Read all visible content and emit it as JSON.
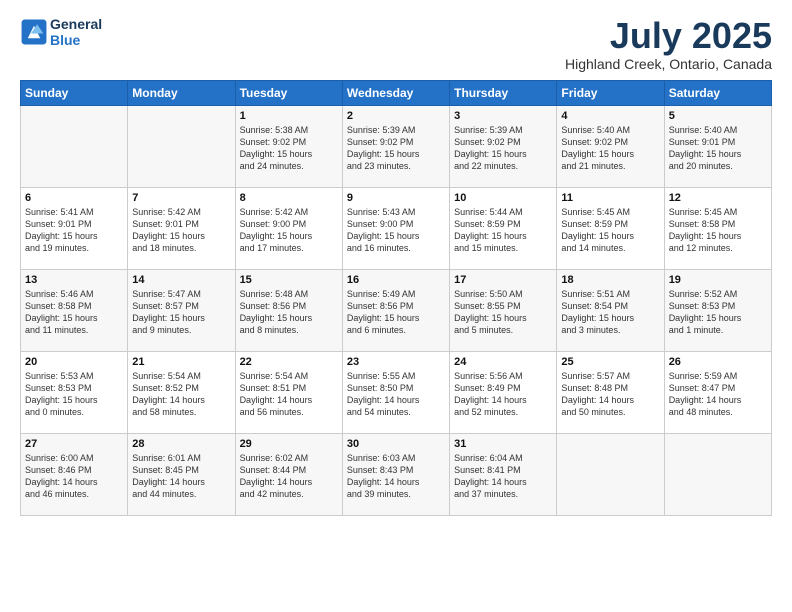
{
  "app": {
    "logo_line1": "General",
    "logo_line2": "Blue"
  },
  "title": "July 2025",
  "location": "Highland Creek, Ontario, Canada",
  "days_of_week": [
    "Sunday",
    "Monday",
    "Tuesday",
    "Wednesday",
    "Thursday",
    "Friday",
    "Saturday"
  ],
  "weeks": [
    [
      {
        "day": "",
        "content": ""
      },
      {
        "day": "",
        "content": ""
      },
      {
        "day": "1",
        "content": "Sunrise: 5:38 AM\nSunset: 9:02 PM\nDaylight: 15 hours\nand 24 minutes."
      },
      {
        "day": "2",
        "content": "Sunrise: 5:39 AM\nSunset: 9:02 PM\nDaylight: 15 hours\nand 23 minutes."
      },
      {
        "day": "3",
        "content": "Sunrise: 5:39 AM\nSunset: 9:02 PM\nDaylight: 15 hours\nand 22 minutes."
      },
      {
        "day": "4",
        "content": "Sunrise: 5:40 AM\nSunset: 9:02 PM\nDaylight: 15 hours\nand 21 minutes."
      },
      {
        "day": "5",
        "content": "Sunrise: 5:40 AM\nSunset: 9:01 PM\nDaylight: 15 hours\nand 20 minutes."
      }
    ],
    [
      {
        "day": "6",
        "content": "Sunrise: 5:41 AM\nSunset: 9:01 PM\nDaylight: 15 hours\nand 19 minutes."
      },
      {
        "day": "7",
        "content": "Sunrise: 5:42 AM\nSunset: 9:01 PM\nDaylight: 15 hours\nand 18 minutes."
      },
      {
        "day": "8",
        "content": "Sunrise: 5:42 AM\nSunset: 9:00 PM\nDaylight: 15 hours\nand 17 minutes."
      },
      {
        "day": "9",
        "content": "Sunrise: 5:43 AM\nSunset: 9:00 PM\nDaylight: 15 hours\nand 16 minutes."
      },
      {
        "day": "10",
        "content": "Sunrise: 5:44 AM\nSunset: 8:59 PM\nDaylight: 15 hours\nand 15 minutes."
      },
      {
        "day": "11",
        "content": "Sunrise: 5:45 AM\nSunset: 8:59 PM\nDaylight: 15 hours\nand 14 minutes."
      },
      {
        "day": "12",
        "content": "Sunrise: 5:45 AM\nSunset: 8:58 PM\nDaylight: 15 hours\nand 12 minutes."
      }
    ],
    [
      {
        "day": "13",
        "content": "Sunrise: 5:46 AM\nSunset: 8:58 PM\nDaylight: 15 hours\nand 11 minutes."
      },
      {
        "day": "14",
        "content": "Sunrise: 5:47 AM\nSunset: 8:57 PM\nDaylight: 15 hours\nand 9 minutes."
      },
      {
        "day": "15",
        "content": "Sunrise: 5:48 AM\nSunset: 8:56 PM\nDaylight: 15 hours\nand 8 minutes."
      },
      {
        "day": "16",
        "content": "Sunrise: 5:49 AM\nSunset: 8:56 PM\nDaylight: 15 hours\nand 6 minutes."
      },
      {
        "day": "17",
        "content": "Sunrise: 5:50 AM\nSunset: 8:55 PM\nDaylight: 15 hours\nand 5 minutes."
      },
      {
        "day": "18",
        "content": "Sunrise: 5:51 AM\nSunset: 8:54 PM\nDaylight: 15 hours\nand 3 minutes."
      },
      {
        "day": "19",
        "content": "Sunrise: 5:52 AM\nSunset: 8:53 PM\nDaylight: 15 hours\nand 1 minute."
      }
    ],
    [
      {
        "day": "20",
        "content": "Sunrise: 5:53 AM\nSunset: 8:53 PM\nDaylight: 15 hours\nand 0 minutes."
      },
      {
        "day": "21",
        "content": "Sunrise: 5:54 AM\nSunset: 8:52 PM\nDaylight: 14 hours\nand 58 minutes."
      },
      {
        "day": "22",
        "content": "Sunrise: 5:54 AM\nSunset: 8:51 PM\nDaylight: 14 hours\nand 56 minutes."
      },
      {
        "day": "23",
        "content": "Sunrise: 5:55 AM\nSunset: 8:50 PM\nDaylight: 14 hours\nand 54 minutes."
      },
      {
        "day": "24",
        "content": "Sunrise: 5:56 AM\nSunset: 8:49 PM\nDaylight: 14 hours\nand 52 minutes."
      },
      {
        "day": "25",
        "content": "Sunrise: 5:57 AM\nSunset: 8:48 PM\nDaylight: 14 hours\nand 50 minutes."
      },
      {
        "day": "26",
        "content": "Sunrise: 5:59 AM\nSunset: 8:47 PM\nDaylight: 14 hours\nand 48 minutes."
      }
    ],
    [
      {
        "day": "27",
        "content": "Sunrise: 6:00 AM\nSunset: 8:46 PM\nDaylight: 14 hours\nand 46 minutes."
      },
      {
        "day": "28",
        "content": "Sunrise: 6:01 AM\nSunset: 8:45 PM\nDaylight: 14 hours\nand 44 minutes."
      },
      {
        "day": "29",
        "content": "Sunrise: 6:02 AM\nSunset: 8:44 PM\nDaylight: 14 hours\nand 42 minutes."
      },
      {
        "day": "30",
        "content": "Sunrise: 6:03 AM\nSunset: 8:43 PM\nDaylight: 14 hours\nand 39 minutes."
      },
      {
        "day": "31",
        "content": "Sunrise: 6:04 AM\nSunset: 8:41 PM\nDaylight: 14 hours\nand 37 minutes."
      },
      {
        "day": "",
        "content": ""
      },
      {
        "day": "",
        "content": ""
      }
    ]
  ]
}
